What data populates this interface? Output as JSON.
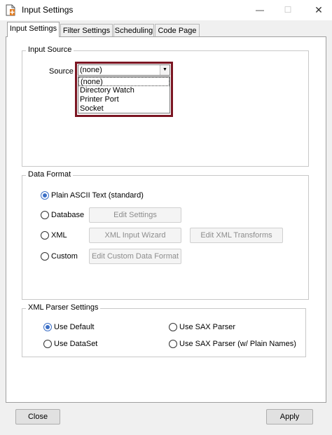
{
  "window": {
    "title": "Input Settings",
    "minimize_glyph": "—",
    "maximize_glyph": "☐",
    "close_glyph": "✕"
  },
  "tabs": [
    {
      "label": "Input Settings",
      "active": true
    },
    {
      "label": "Filter Settings",
      "active": false
    },
    {
      "label": "Scheduling",
      "active": false
    },
    {
      "label": "Code Page",
      "active": false
    }
  ],
  "input_source": {
    "group_title": "Input Source",
    "source_label": "Source",
    "selected": "(none)",
    "options": [
      "(none)",
      "Directory Watch",
      "Printer Port",
      "Socket"
    ]
  },
  "data_format": {
    "group_title": "Data Format",
    "options": [
      {
        "label": "Plain ASCII Text (standard)",
        "checked": true
      },
      {
        "label": "Database",
        "checked": false
      },
      {
        "label": "XML",
        "checked": false
      },
      {
        "label": "Custom",
        "checked": false
      }
    ],
    "buttons": {
      "edit_settings": "Edit Settings",
      "xml_input_wizard": "XML Input Wizard",
      "edit_xml_transforms": "Edit XML Transforms",
      "edit_custom_format": "Edit Custom Data Format"
    }
  },
  "xml_parser": {
    "group_title": "XML Parser Settings",
    "options": [
      {
        "label": "Use Default",
        "checked": true
      },
      {
        "label": "Use DataSet",
        "checked": false
      },
      {
        "label": "Use SAX Parser",
        "checked": false
      },
      {
        "label": "Use SAX Parser (w/ Plain Names)",
        "checked": false
      }
    ]
  },
  "footer": {
    "close_label": "Close",
    "apply_label": "Apply"
  },
  "colors": {
    "highlight_border": "#7b1522",
    "radio_accent": "#3c6fc6"
  },
  "icons": {
    "app": "document-plus-icon",
    "combo_arrow": "chevron-down-icon"
  }
}
